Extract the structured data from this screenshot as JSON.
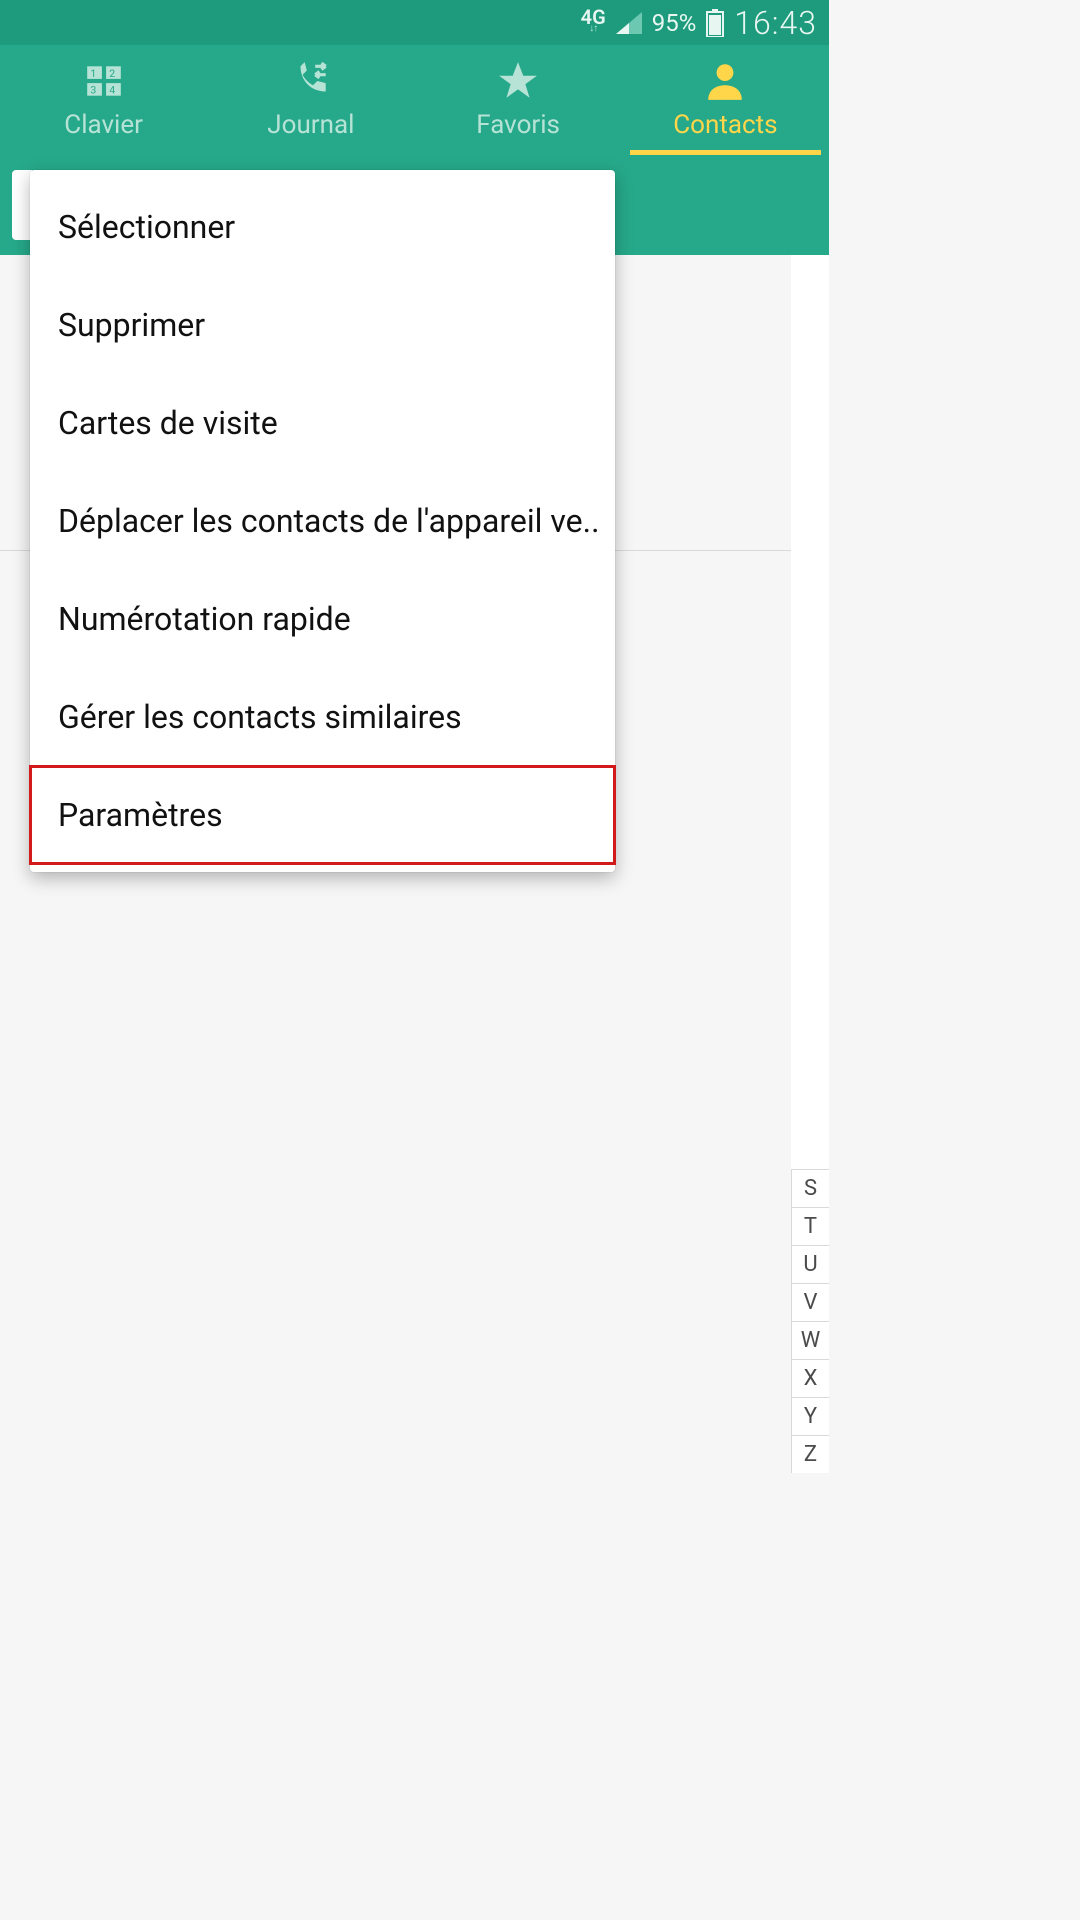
{
  "status_bar": {
    "network_label": "4G",
    "battery_percent": "95%",
    "time": "16:43"
  },
  "tabs": [
    {
      "id": "keypad",
      "label": "Clavier",
      "icon": "keypad-icon",
      "active": false
    },
    {
      "id": "log",
      "label": "Journal",
      "icon": "call-log-icon",
      "active": false
    },
    {
      "id": "fav",
      "label": "Favoris",
      "icon": "star-icon",
      "active": false
    },
    {
      "id": "contacts",
      "label": "Contacts",
      "icon": "person-icon",
      "active": true
    }
  ],
  "menu": {
    "items": [
      "Sélectionner",
      "Supprimer",
      "Cartes de visite",
      "Déplacer les contacts de l'appareil ve..",
      "Numérotation rapide",
      "Gérer les contacts similaires",
      "Paramètres"
    ],
    "highlighted_index": 6
  },
  "alpha_index": [
    "S",
    "T",
    "U",
    "V",
    "W",
    "X",
    "Y",
    "Z"
  ],
  "colors": {
    "status_bg": "#1e9b7c",
    "tab_bg": "#26a98a",
    "tab_inactive": "#b6e3d6",
    "tab_active": "#ffd54a",
    "highlight_border": "#d11a1a"
  }
}
